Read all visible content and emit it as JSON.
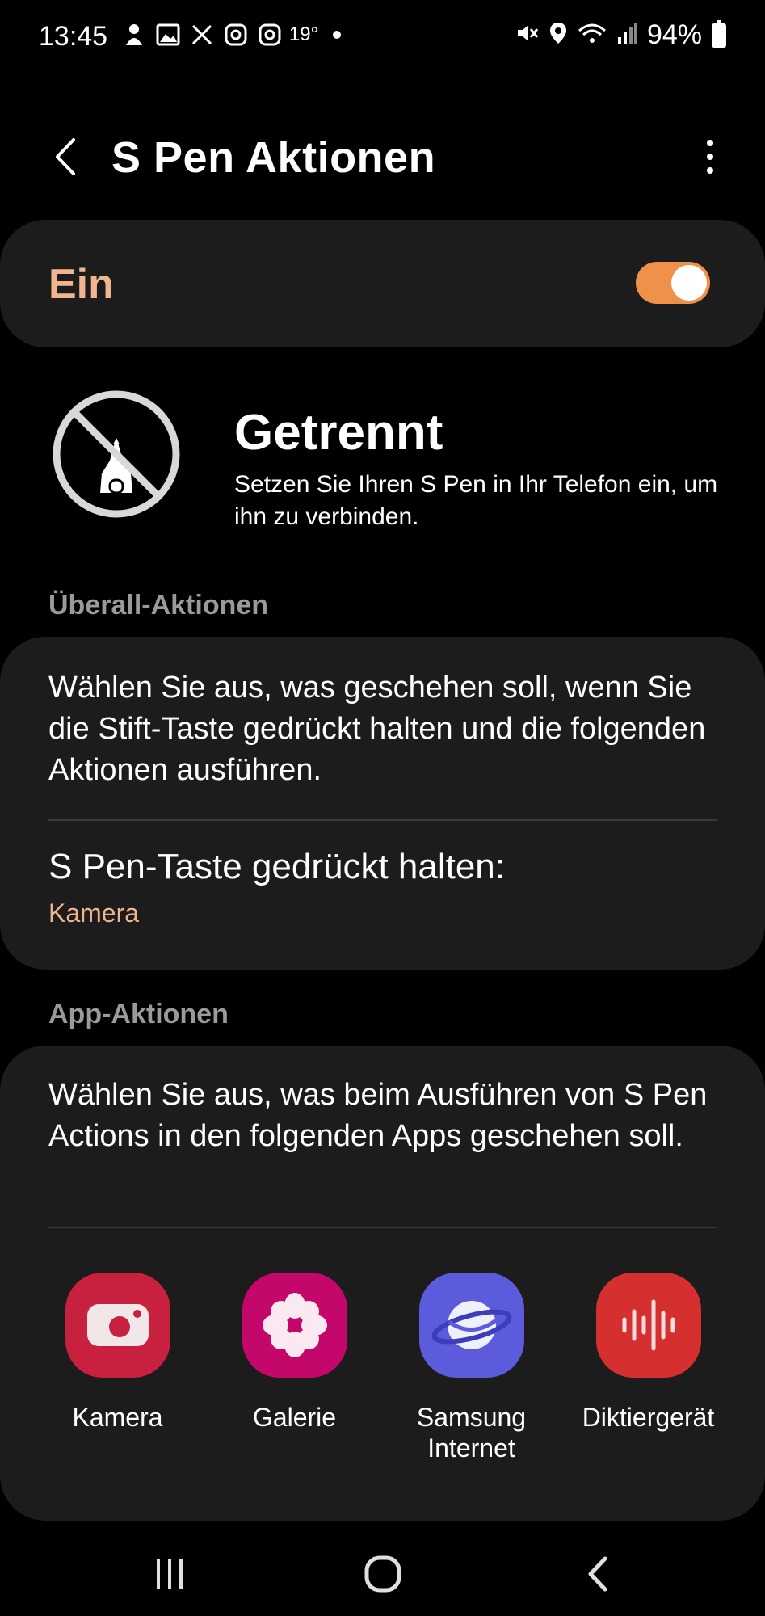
{
  "status_bar": {
    "time": "13:45",
    "temperature": "19°",
    "battery": "94%"
  },
  "header": {
    "title": "S Pen Aktionen"
  },
  "master_toggle": {
    "label": "Ein",
    "state": true
  },
  "connection": {
    "title": "Getrennt",
    "description": "Setzen Sie Ihren S Pen in Ihr Telefon ein, um ihn zu verbinden."
  },
  "anywhere_actions": {
    "section_label": "Überall-Aktionen",
    "description": "Wählen Sie aus, was geschehen soll, wenn Sie die Stift-Taste gedrückt halten und die folgenden Aktionen ausführen.",
    "hold_title": "S Pen-Taste gedrückt halten:",
    "hold_value": "Kamera"
  },
  "app_actions": {
    "section_label": "App-Aktionen",
    "description": "Wählen Sie aus, was beim Ausführen von S Pen Actions in den folgenden Apps geschehen soll.",
    "apps": [
      {
        "label": "Kamera",
        "icon": "camera-icon",
        "color": "#c8203f"
      },
      {
        "label": "Galerie",
        "icon": "flower-icon",
        "color": "#c4086b"
      },
      {
        "label": "Samsung\nInternet",
        "icon": "planet-icon",
        "color": "#5b5bdc"
      },
      {
        "label": "Diktiergerät",
        "icon": "sound-wave-icon",
        "color": "#d62f2f"
      }
    ]
  },
  "colors": {
    "accent": "#f0914a",
    "accent_text": "#f0b58e",
    "card_bg": "#1c1c1c",
    "background": "#000000"
  }
}
